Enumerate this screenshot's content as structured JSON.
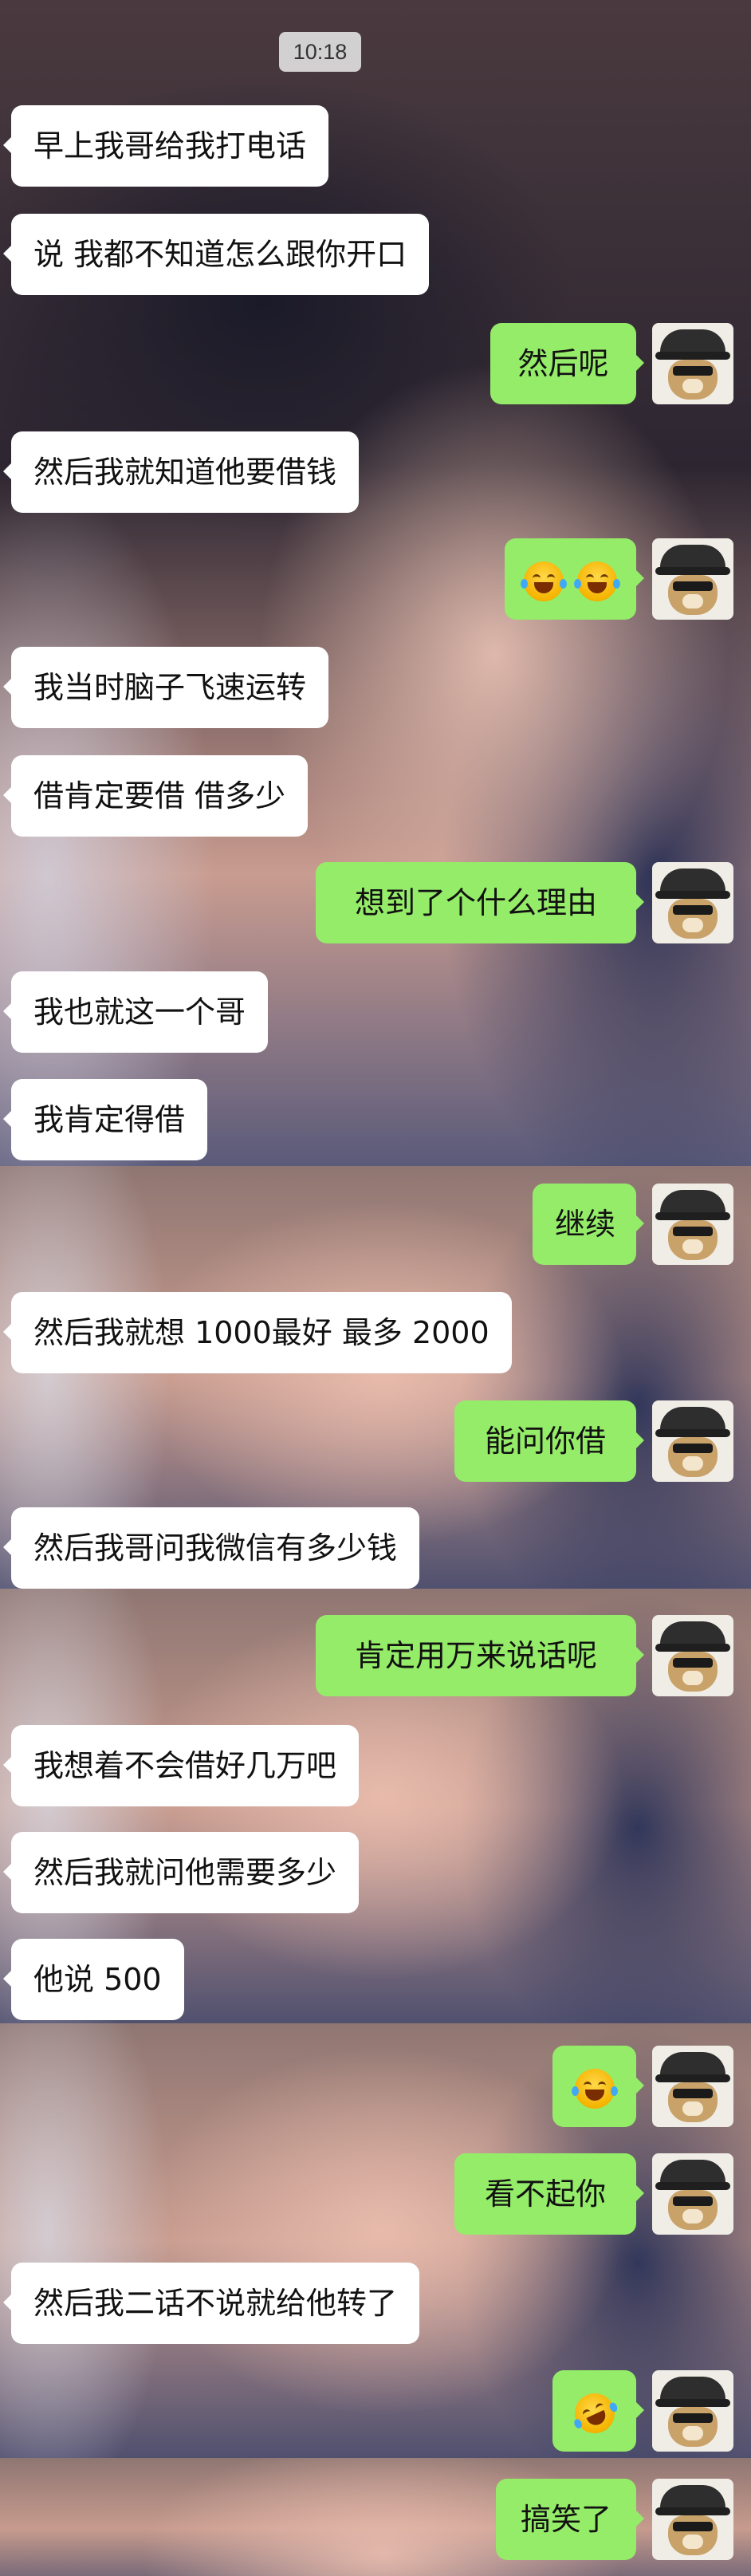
{
  "status": {
    "time": "10:18"
  },
  "messages": [
    {
      "side": "left",
      "text": "早上我哥给我打电话"
    },
    {
      "side": "left",
      "text": "说 我都不知道怎么跟你开口"
    },
    {
      "side": "right",
      "text": "然后呢"
    },
    {
      "side": "left",
      "text": "然后我就知道他要借钱"
    },
    {
      "side": "right",
      "text": "",
      "emoji": [
        "face-with-tears-of-joy",
        "face-with-tears-of-joy"
      ]
    },
    {
      "side": "left",
      "text": "我当时脑子飞速运转"
    },
    {
      "side": "left",
      "text": "借肯定要借 借多少"
    },
    {
      "side": "right",
      "text": "想到了个什么理由"
    },
    {
      "side": "left",
      "text": "我也就这一个哥"
    },
    {
      "side": "left",
      "text": "我肯定得借"
    },
    {
      "side": "right",
      "text": "继续"
    },
    {
      "side": "left",
      "text": "然后我就想 1000最好 最多 2000"
    },
    {
      "side": "right",
      "text": "能问你借"
    },
    {
      "side": "left",
      "text": "然后我哥问我微信有多少钱"
    },
    {
      "side": "right",
      "text": "肯定用万来说话呢"
    },
    {
      "side": "left",
      "text": "我想着不会借好几万吧"
    },
    {
      "side": "left",
      "text": "然后我就问他需要多少"
    },
    {
      "side": "left",
      "text": "他说 500"
    },
    {
      "side": "right",
      "text": "",
      "emoji": [
        "face-with-tears-of-joy"
      ]
    },
    {
      "side": "right",
      "text": "看不起你"
    },
    {
      "side": "left",
      "text": "然后我二话不说就给他转了"
    },
    {
      "side": "right",
      "text": "",
      "emoji": [
        "rolling-on-floor-laughing"
      ]
    },
    {
      "side": "right",
      "text": "搞笑了"
    }
  ],
  "avatar": {
    "icon": "shiba-dog-with-cap-avatar"
  },
  "colors": {
    "incoming_bubble": "#ffffff",
    "outgoing_bubble": "#95ec69",
    "time_pill": "#e6e6e6"
  }
}
